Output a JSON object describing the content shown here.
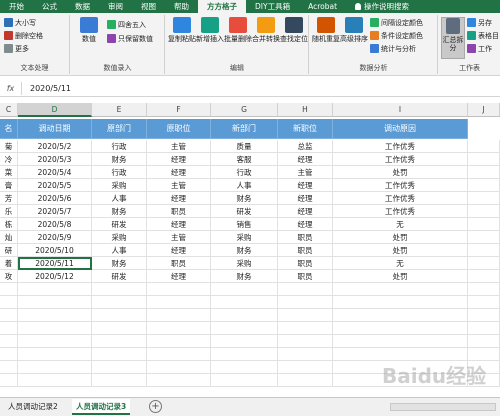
{
  "menu": {
    "tabs": [
      "开始",
      "公式",
      "数据",
      "审阅",
      "视图",
      "帮助",
      "方方格子",
      "DIY工具箱",
      "Acrobat"
    ],
    "active_tab": "方方格子",
    "search_label": "操作说明搜索"
  },
  "ribbon": {
    "text_group": {
      "label": "文本处理",
      "case_label": "大小写",
      "remove_space_label": "删除空格",
      "more_label": "更多"
    },
    "number_group": {
      "label": "数值录入",
      "value_label": "数值",
      "round_label": "四舍五入",
      "keep_value_label": "只保留数值"
    },
    "edit_group": {
      "label": "编辑",
      "buttons": [
        "复制粘贴",
        "新增插入",
        "批量删除",
        "合并转换",
        "查找定位"
      ]
    },
    "analysis_group": {
      "label": "数据分析",
      "random_label": "随机重复",
      "sort_label": "高级排序",
      "interval_color_label": "间隔设定颜色",
      "cond_color_label": "条件设定颜色",
      "stats_label": "统计与分析"
    },
    "sheet_group": {
      "label": "工作表",
      "summary_label": "汇总拆分",
      "save_as_label": "另存",
      "table_label": "表格目",
      "work_label": "工作"
    }
  },
  "formula_bar": {
    "fx": "fx",
    "value": "2020/5/11"
  },
  "columns": [
    "C",
    "D",
    "E",
    "F",
    "G",
    "H",
    "I",
    "J"
  ],
  "table": {
    "headers": [
      "名",
      "调动日期",
      "原部门",
      "原职位",
      "新部门",
      "新职位",
      "调动原因"
    ],
    "rows": [
      [
        "菊",
        "2020/5/2",
        "行政",
        "主管",
        "质量",
        "总监",
        "工作优秀"
      ],
      [
        "冷",
        "2020/5/3",
        "财务",
        "经理",
        "客服",
        "经理",
        "工作优秀"
      ],
      [
        "菜",
        "2020/5/4",
        "行政",
        "经理",
        "行政",
        "主管",
        "处罚"
      ],
      [
        "膏",
        "2020/5/5",
        "采购",
        "主管",
        "人事",
        "经理",
        "工作优秀"
      ],
      [
        "芳",
        "2020/5/6",
        "人事",
        "经理",
        "财务",
        "经理",
        "工作优秀"
      ],
      [
        "乐",
        "2020/5/7",
        "财务",
        "职员",
        "研发",
        "经理",
        "工作优秀"
      ],
      [
        "栋",
        "2020/5/8",
        "研发",
        "经理",
        "销售",
        "经理",
        "无"
      ],
      [
        "灿",
        "2020/5/9",
        "采购",
        "主管",
        "采购",
        "职员",
        "处罚"
      ],
      [
        "研",
        "2020/5/10",
        "人事",
        "经理",
        "财务",
        "职员",
        "处罚"
      ],
      [
        "着",
        "2020/5/11",
        "财务",
        "职员",
        "采购",
        "职员",
        "无"
      ],
      [
        "攻",
        "2020/5/12",
        "研发",
        "经理",
        "财务",
        "职员",
        "处罚"
      ]
    ]
  },
  "sheets": {
    "tab1": "人员调动记录2",
    "tab2": "人员调动记录3",
    "add": "+"
  },
  "watermark": "Baidu经验",
  "colors": {
    "excel_green": "#217346",
    "header_blue": "#5b9bd5"
  }
}
